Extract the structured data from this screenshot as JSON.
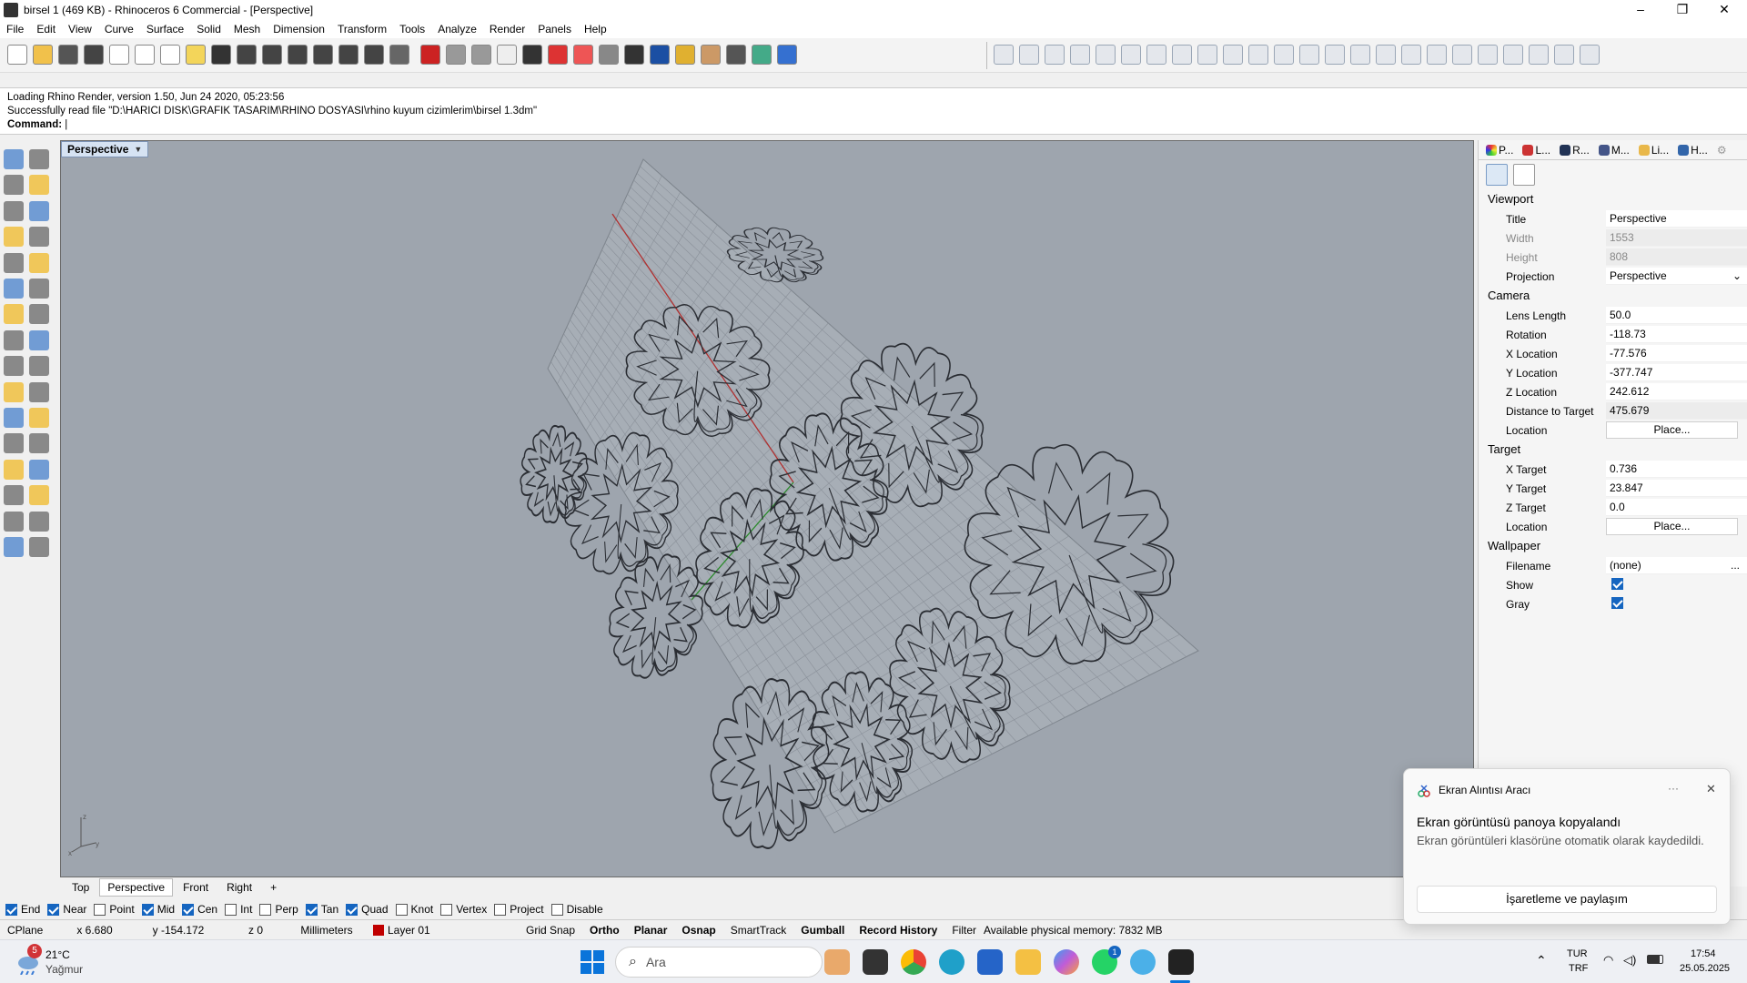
{
  "window": {
    "title": "birsel 1 (469 KB) - Rhinoceros 6 Commercial - [Perspective]",
    "minimize": "–",
    "maximize": "❐",
    "close": "✕"
  },
  "menu": [
    "File",
    "Edit",
    "View",
    "Curve",
    "Surface",
    "Solid",
    "Mesh",
    "Dimension",
    "Transform",
    "Tools",
    "Analyze",
    "Render",
    "Panels",
    "Help"
  ],
  "command": {
    "line1": "Loading Rhino Render, version 1.50, Jun 24 2020, 05:23:56",
    "line2": "Successfully read file \"D:\\HARICI DISK\\GRAFIK TASARIM\\RHINO DOSYASI\\rhino kuyum cizimlerim\\birsel 1.3dm\"",
    "prompt": "Command:"
  },
  "viewport": {
    "label": "Perspective",
    "tabs": [
      "Top",
      "Perspective",
      "Front",
      "Right"
    ],
    "active_tab": "Perspective",
    "add_tab": "+",
    "background": "#9ea5ae"
  },
  "osnaps": [
    {
      "label": "End",
      "checked": true
    },
    {
      "label": "Near",
      "checked": true
    },
    {
      "label": "Point",
      "checked": false
    },
    {
      "label": "Mid",
      "checked": true
    },
    {
      "label": "Cen",
      "checked": true
    },
    {
      "label": "Int",
      "checked": false
    },
    {
      "label": "Perp",
      "checked": false
    },
    {
      "label": "Tan",
      "checked": true
    },
    {
      "label": "Quad",
      "checked": true
    },
    {
      "label": "Knot",
      "checked": false
    },
    {
      "label": "Vertex",
      "checked": false
    },
    {
      "label": "Project",
      "checked": false
    },
    {
      "label": "Disable",
      "checked": false
    }
  ],
  "status": {
    "cplane": "CPlane",
    "x": "x 6.680",
    "y": "y -154.172",
    "z": "z 0",
    "units": "Millimeters",
    "layer": "Layer 01",
    "layer_color": "#c00000",
    "grid_snap": "Grid Snap",
    "ortho": "Ortho",
    "planar": "Planar",
    "osnap": "Osnap",
    "smarttrack": "SmartTrack",
    "gumball": "Gumball",
    "record_history": "Record History",
    "filter": "Filter",
    "memory": "Available physical memory: 7832 MB"
  },
  "panel": {
    "tabs": [
      "P...",
      "L...",
      "R...",
      "M...",
      "Li...",
      "H..."
    ],
    "viewport_section": "Viewport",
    "camera_section": "Camera",
    "target_section": "Target",
    "wallpaper_section": "Wallpaper",
    "title_label": "Title",
    "title_value": "Perspective",
    "width_label": "Width",
    "width_value": "1553",
    "height_label": "Height",
    "height_value": "808",
    "projection_label": "Projection",
    "projection_value": "Perspective",
    "lens_label": "Lens Length",
    "lens_value": "50.0",
    "rotation_label": "Rotation",
    "rotation_value": "-118.73",
    "xloc_label": "X Location",
    "xloc_value": "-77.576",
    "yloc_label": "Y Location",
    "yloc_value": "-377.747",
    "zloc_label": "Z Location",
    "zloc_value": "242.612",
    "dist_label": "Distance to Target",
    "dist_value": "475.679",
    "loc_label": "Location",
    "place_label": "Place...",
    "xt_label": "X Target",
    "xt_value": "0.736",
    "yt_label": "Y Target",
    "yt_value": "23.847",
    "zt_label": "Z Target",
    "zt_value": "0.0",
    "tloc_label": "Location",
    "filename_label": "Filename",
    "filename_value": "(none)",
    "browse_label": "...",
    "show_label": "Show",
    "show_checked": true,
    "gray_label": "Gray",
    "gray_checked": true
  },
  "toast": {
    "app": "Ekran Alıntısı Aracı",
    "more": "···",
    "close": "✕",
    "heading": "Ekran görüntüsü panoya kopyalandı",
    "body": "Ekran görüntüleri klasörüne otomatik olarak kaydedildi.",
    "button": "İşaretleme ve paylaşım"
  },
  "taskbar": {
    "weather_badge": "5",
    "temp": "21°C",
    "condition": "Yağmur",
    "search": "Ara",
    "whatsapp_badge": "1",
    "lang1": "TUR",
    "lang2": "TRF",
    "time": "17:54",
    "date": "25.05.2025"
  }
}
